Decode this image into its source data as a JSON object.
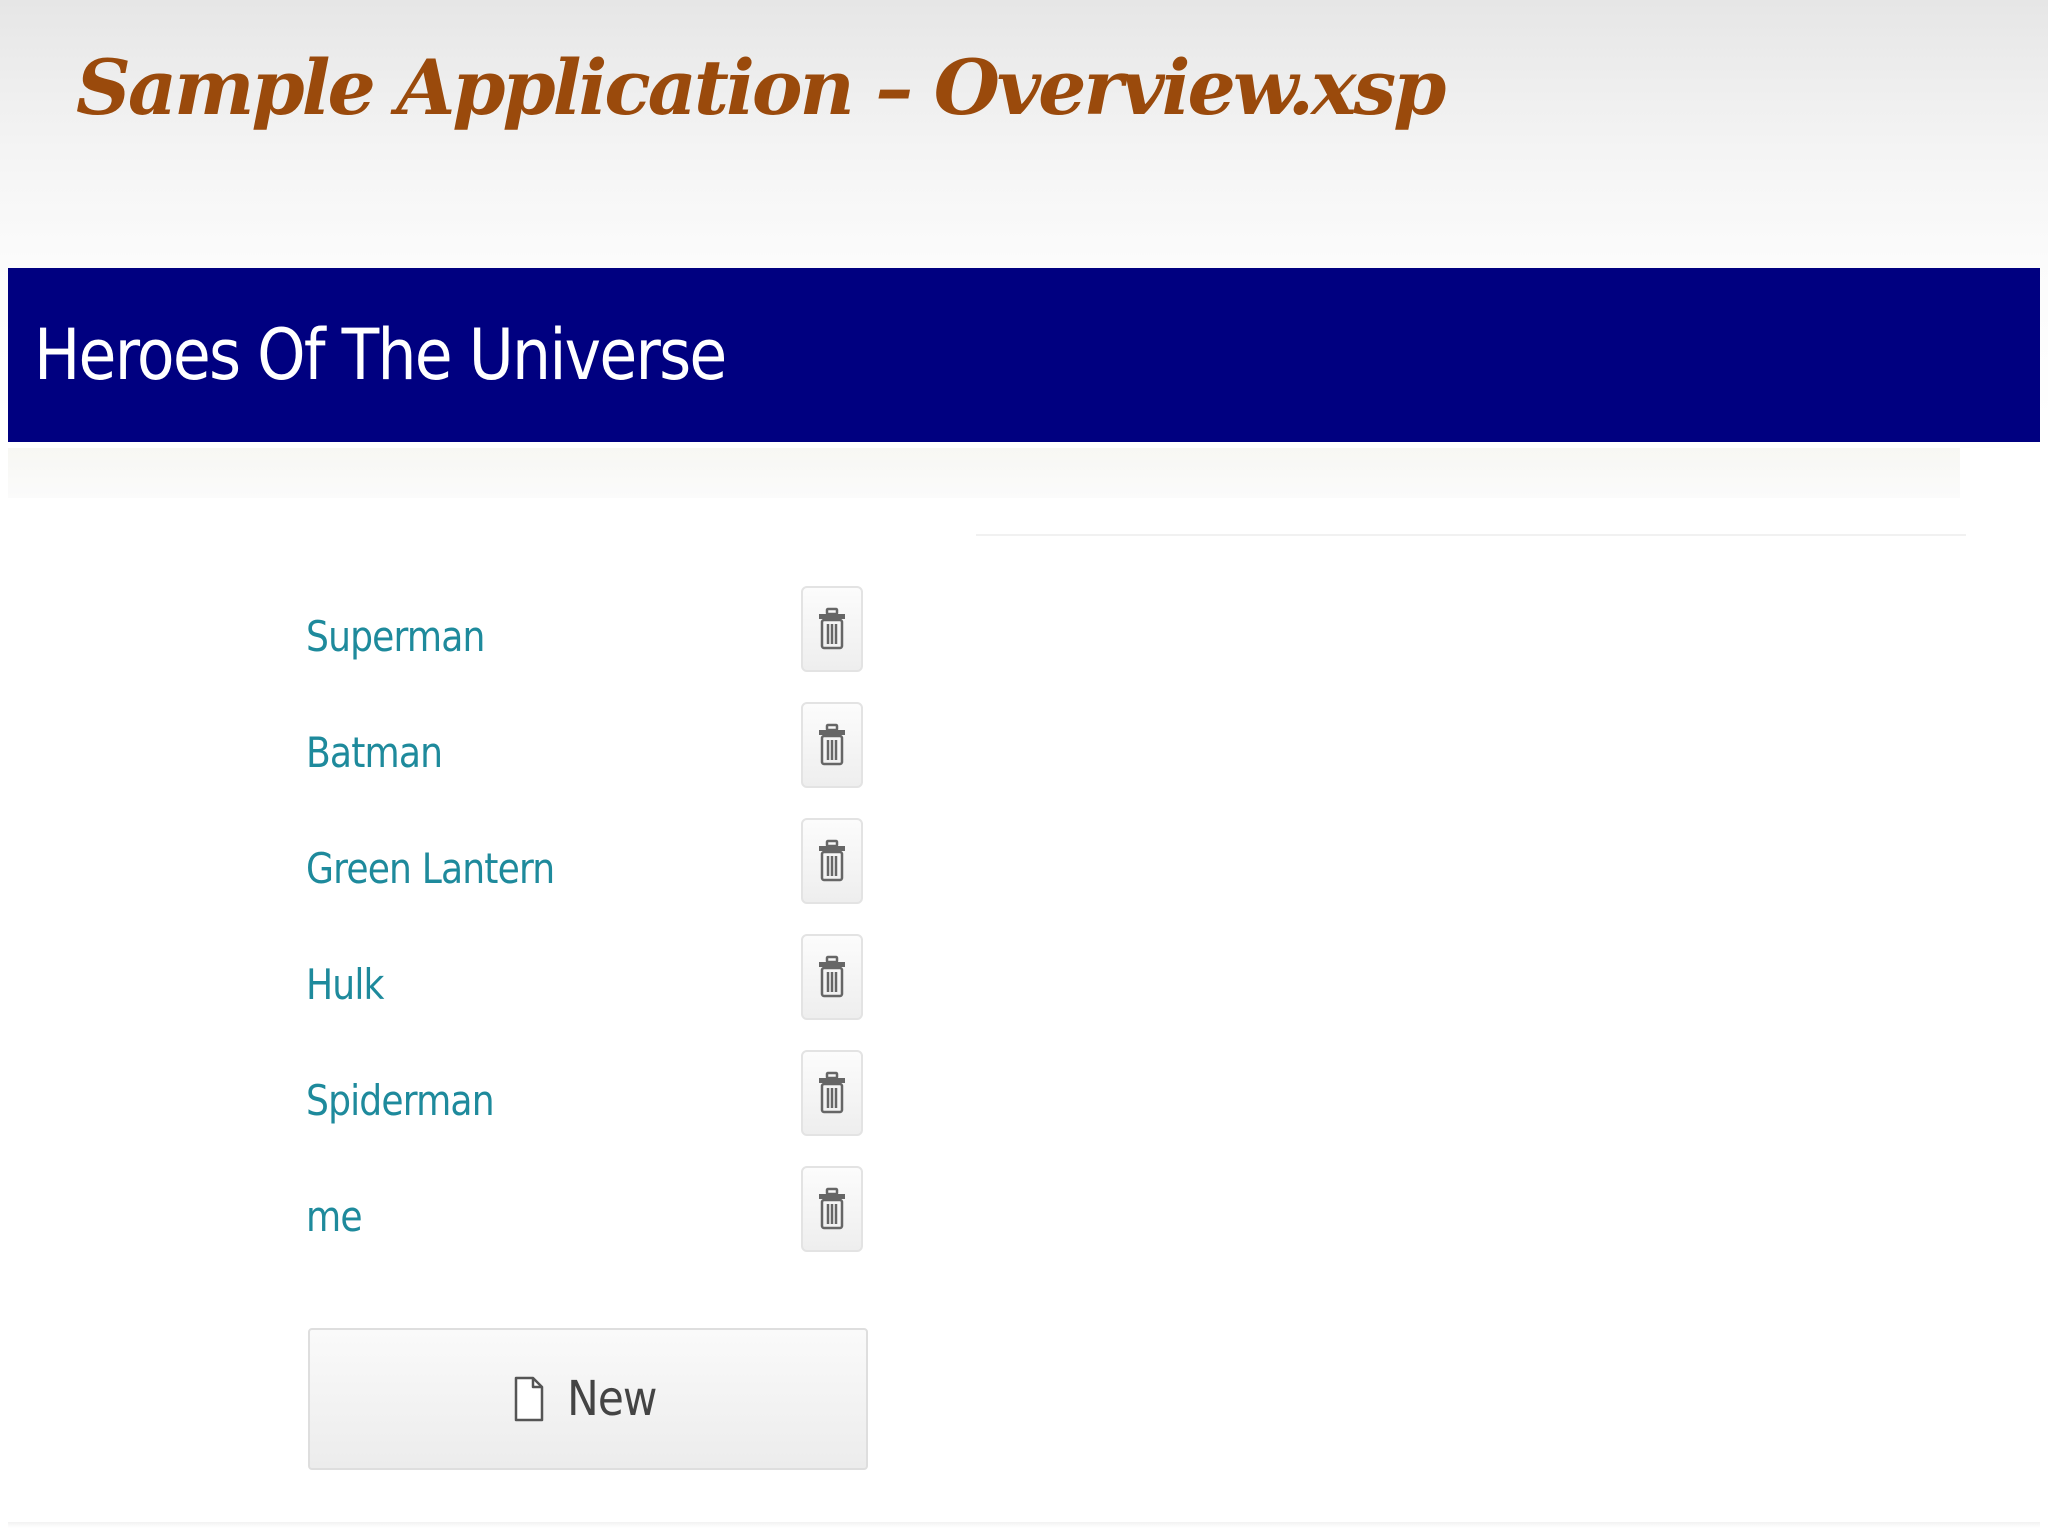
{
  "slide": {
    "title": "Sample Application – Overview.xsp"
  },
  "app": {
    "title": "Heroes Of The Universe",
    "heroes": [
      {
        "name": "Superman"
      },
      {
        "name": "Batman"
      },
      {
        "name": "Green Lantern"
      },
      {
        "name": "Hulk"
      },
      {
        "name": "Spiderman"
      },
      {
        "name": "me"
      }
    ],
    "new_button_label": "New",
    "delete_icon": "trash-icon",
    "new_icon": "document-icon"
  },
  "colors": {
    "slide_title": "#9a4a0c",
    "header_background": "#000080",
    "header_text": "#ffffff",
    "hero_link": "#1e8a9c"
  }
}
